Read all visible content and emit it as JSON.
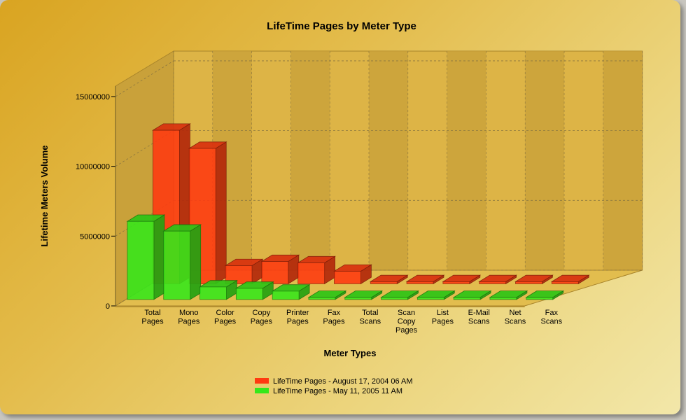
{
  "chart_data": {
    "type": "bar",
    "title": "LifeTime Pages by Meter Type",
    "xlabel": "Meter Types",
    "ylabel": "Lifetime Meters Volume",
    "ylim": [
      0,
      15000000
    ],
    "yticks": [
      "0",
      "5000000",
      "10000000",
      "15000000"
    ],
    "categories": [
      [
        "Total",
        "Pages"
      ],
      [
        "Mono",
        "Pages"
      ],
      [
        "Color",
        "Pages"
      ],
      [
        "Copy",
        "Pages"
      ],
      [
        "Printer",
        "Pages"
      ],
      [
        "Fax",
        "Pages"
      ],
      [
        "Total",
        "Scans"
      ],
      [
        "Scan",
        "Copy",
        "Pages"
      ],
      [
        "List",
        "Pages"
      ],
      [
        "E-Mail",
        "Scans"
      ],
      [
        "Net",
        "Scans"
      ],
      [
        "Fax",
        "Scans"
      ]
    ],
    "series": [
      {
        "name": "LifeTime Pages - August 17, 2004 06 AM",
        "color": "#ff3a10",
        "values": [
          11000000,
          9700000,
          1300000,
          1600000,
          1500000,
          900000,
          60000,
          60000,
          0,
          60000,
          60000,
          60000
        ]
      },
      {
        "name": "LifeTime Pages - May 11, 2005 11 AM",
        "color": "#35e81a",
        "values": [
          5600000,
          4900000,
          900000,
          800000,
          600000,
          60000,
          60000,
          60000,
          60000,
          60000,
          60000,
          0
        ]
      }
    ],
    "grid": true,
    "legend_position": "bottom"
  }
}
